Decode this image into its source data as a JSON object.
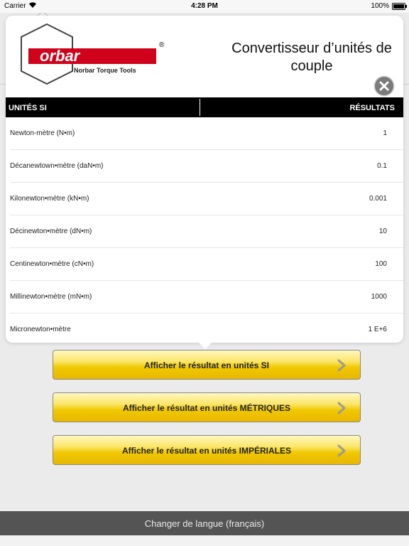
{
  "status_bar": {
    "carrier": "Carrier",
    "time": "4:28 PM",
    "battery": "100%"
  },
  "logo": {
    "brand": "Norbar",
    "tagline": "Norbar Torque Tools",
    "registered": "®"
  },
  "popover": {
    "title": "Convertisseur d’unités de couple",
    "close_icon": "close-icon",
    "table": {
      "headers": [
        "UNITÉS SI",
        "RÉSULTATS"
      ],
      "rows": [
        {
          "unit": "Newton-mètre (N•m)",
          "value": "1"
        },
        {
          "unit": "Décanewtown•mètre (daN•m)",
          "value": "0.1"
        },
        {
          "unit": "Kilonewton•mètre (kN•m)",
          "value": "0.001"
        },
        {
          "unit": "Décinewton•mètre (dN•m)",
          "value": "10"
        },
        {
          "unit": "Centinewton•mètre (cN•m)",
          "value": "100"
        },
        {
          "unit": "Millinewton•mètre (mN•m)",
          "value": "1000"
        },
        {
          "unit": "Micronewton•mètre",
          "value": "1 E+6"
        }
      ]
    }
  },
  "actions": [
    {
      "label": "Afficher le résultat en unités SI",
      "icon": "chevron-right-icon"
    },
    {
      "label": "Afficher le résultat en unités MÉTRIQUES",
      "icon": "chevron-right-icon"
    },
    {
      "label": "Afficher le résultat en unités IMPÉRIALES",
      "icon": "chevron-right-icon"
    }
  ],
  "footer": {
    "language_label": "Changer de langue (français)"
  },
  "colors": {
    "brand_red": "#d0021b",
    "button_gold": "#f0c800",
    "header_black": "#000000",
    "footer_gray": "#545454"
  }
}
